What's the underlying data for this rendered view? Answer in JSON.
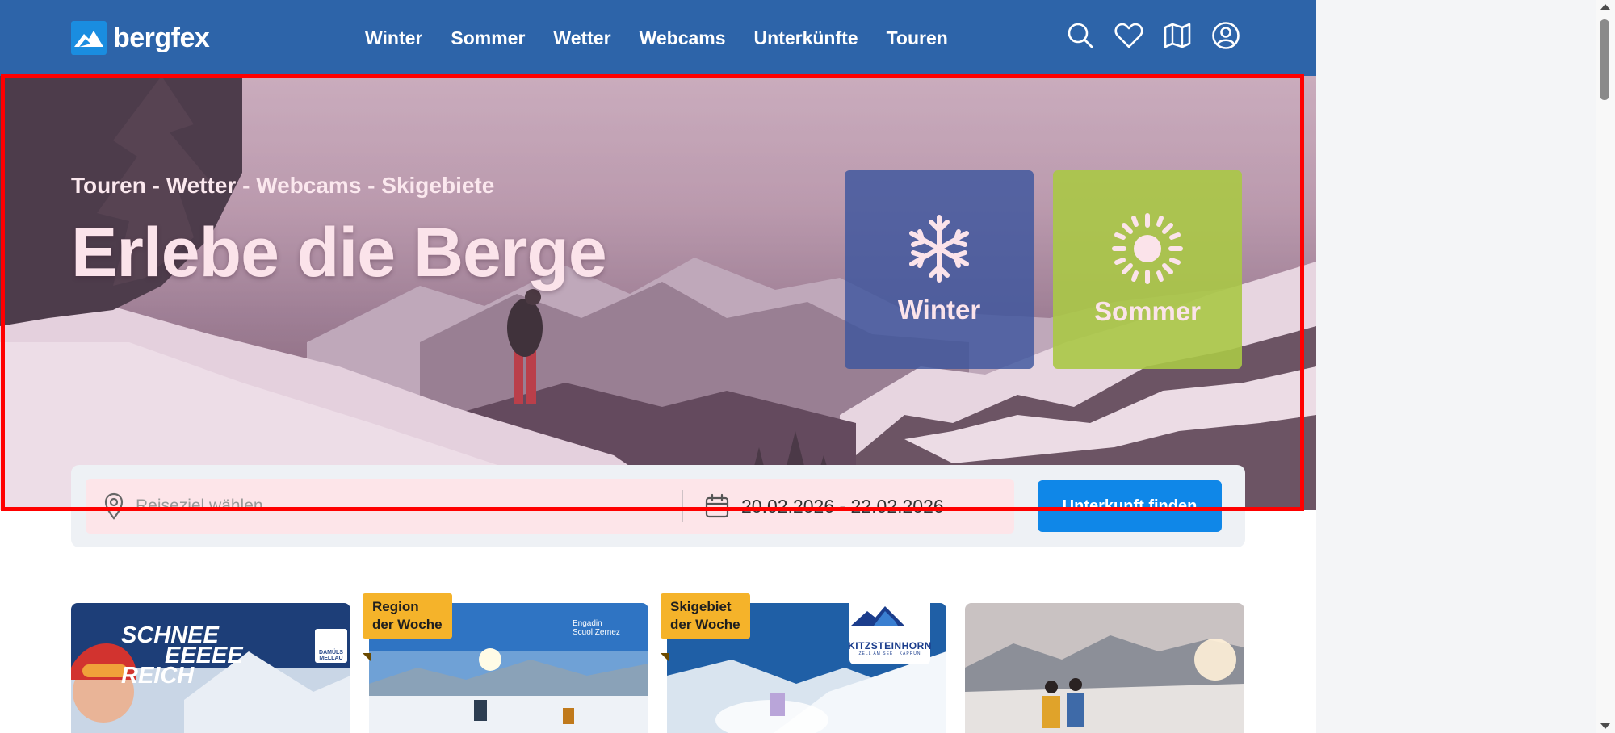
{
  "header": {
    "logo_text": "bergfex",
    "nav": [
      "Winter",
      "Sommer",
      "Wetter",
      "Webcams",
      "Unterkünfte",
      "Touren"
    ],
    "icons": [
      "search-icon",
      "heart-icon",
      "map-icon",
      "user-icon"
    ]
  },
  "hero": {
    "tagline": "Touren - Wetter - Webcams - Skigebiete",
    "title": "Erlebe die Berge",
    "tiles": {
      "winter": {
        "label": "Winter",
        "icon": "snowflake-icon",
        "color": "#3d569e"
      },
      "summer": {
        "label": "Sommer",
        "icon": "sun-icon",
        "color": "#aac846"
      }
    }
  },
  "search": {
    "destination_placeholder": "Reiseziel wählen",
    "dates": "20.02.2026 - 22.02.2026",
    "button": "Unterkunft finden"
  },
  "cards": [
    {
      "text_lines": [
        "SCHNEE",
        "EEEEE",
        "REICH"
      ],
      "logo_text": "DAMÜLS MELLAU"
    },
    {
      "badge_lines": [
        "Region",
        "der Woche"
      ],
      "brand_lines": [
        "Engadin",
        "Scuol Zernez"
      ]
    },
    {
      "badge_lines": [
        "Skigebiet",
        "der Woche"
      ],
      "logo_text": "KITZSTEINHORN",
      "logo_sub": "ZELL AM SEE · KAPRUN"
    },
    {}
  ],
  "colors": {
    "header_bg": "#2d64a9",
    "cta_blue": "#0f87e8",
    "badge_yellow": "#f5b32a",
    "highlight": "#ff0000"
  }
}
